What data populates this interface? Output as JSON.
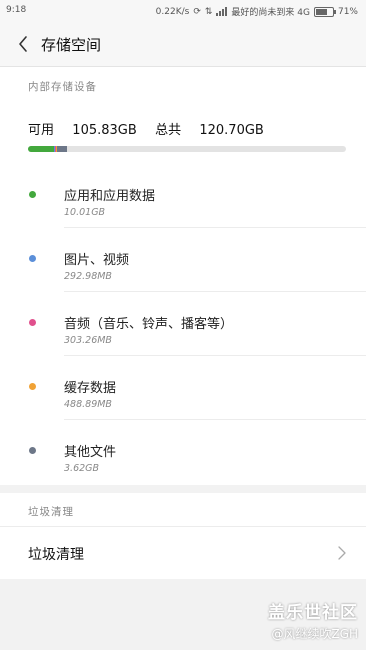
{
  "status_bar": {
    "time": "9:18",
    "speed": "0.22K/s",
    "carrier": "最好的尚未到来 4G",
    "battery": "71%"
  },
  "header": {
    "title": "存储空间"
  },
  "internal": {
    "label": "内部存储设备",
    "available_label": "可用",
    "available_value": "105.83GB",
    "total_label": "总共",
    "total_value": "120.70GB",
    "usage_segments": [
      {
        "name": "应用和应用数据",
        "color": "#43a83d",
        "fraction": 0.0829
      },
      {
        "name": "图片、视频",
        "color": "#5b8fd9",
        "fraction": 0.0024
      },
      {
        "name": "音频（音乐、铃声、播客等）",
        "color": "#e0508d",
        "fraction": 0.0025
      },
      {
        "name": "缓存数据",
        "color": "#f0a236",
        "fraction": 0.004
      },
      {
        "name": "其他文件",
        "color": "#6d7788",
        "fraction": 0.03
      }
    ],
    "categories": [
      {
        "name": "应用和应用数据",
        "size": "10.01GB",
        "color": "#43a83d"
      },
      {
        "name": "图片、视频",
        "size": "292.98MB",
        "color": "#5b8fd9"
      },
      {
        "name": "音频（音乐、铃声、播客等）",
        "size": "303.26MB",
        "color": "#e0508d"
      },
      {
        "name": "缓存数据",
        "size": "488.89MB",
        "color": "#f0a236"
      },
      {
        "name": "其他文件",
        "size": "3.62GB",
        "color": "#6d7788"
      }
    ]
  },
  "junk": {
    "section_label": "垃圾清理",
    "row_label": "垃圾清理"
  },
  "watermark": {
    "line1": "盖乐世社区",
    "line2": "@风继续吹ZGH"
  }
}
